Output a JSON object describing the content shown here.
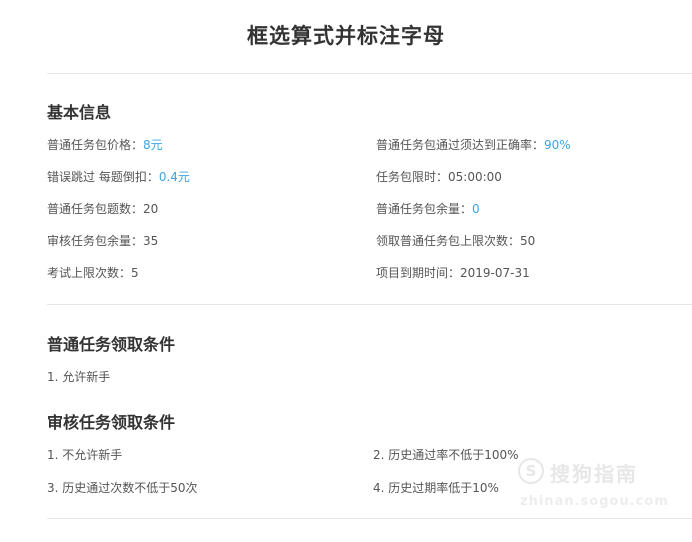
{
  "page": {
    "title": "框选算式并标注字母"
  },
  "basic_info": {
    "heading": "基本信息",
    "fields": [
      {
        "label": "普通任务包价格：",
        "value": "8元"
      },
      {
        "label": "普通任务包通过须达到正确率：",
        "value": "90%"
      },
      {
        "label": "错误跳过 每题倒扣：",
        "value": "0.4元"
      },
      {
        "label": "任务包限时：",
        "value": "05:00:00"
      },
      {
        "label": "普通任务包题数：",
        "value": "20"
      },
      {
        "label": "普通任务包余量：",
        "value": "0"
      },
      {
        "label": "审核任务包余量：",
        "value": "35"
      },
      {
        "label": "领取普通任务包上限次数：",
        "value": "50"
      },
      {
        "label": "考试上限次数：",
        "value": "5"
      },
      {
        "label": "项目到期时间：",
        "value": "2019-07-31"
      }
    ]
  },
  "normal_conditions": {
    "heading": "普通任务领取条件",
    "items": [
      "1. 允许新手"
    ]
  },
  "review_conditions": {
    "heading": "审核任务领取条件",
    "items": [
      "1. 不允许新手",
      "2. 历史通过率不低于100%",
      "3. 历史通过次数不低于50次",
      "4. 历史过期率低于10%"
    ]
  },
  "watermark": {
    "icon_glyph": "S",
    "brand": "搜狗指南",
    "url": "zhinan.sogou.com"
  },
  "colors": {
    "accent": "#3ea3e0",
    "text": "#333333",
    "divider": "#e6e6e6"
  }
}
